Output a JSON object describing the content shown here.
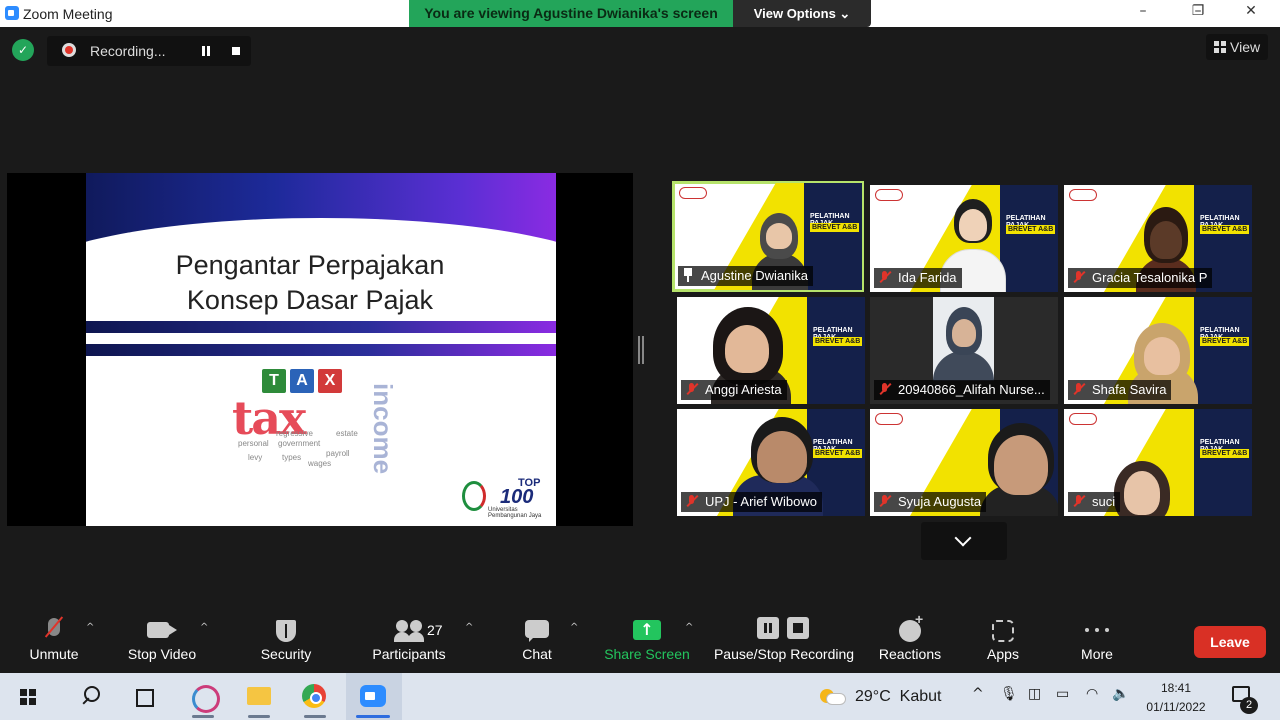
{
  "window": {
    "title": "Zoom Meeting",
    "controls": [
      "–",
      "❐",
      "✕"
    ]
  },
  "share_banner": {
    "text": "You are viewing Agustine Dwianika's screen",
    "view_options": "View Options ⌄"
  },
  "recording": {
    "label": "Recording..."
  },
  "view_button": "View",
  "slide": {
    "title_line1": "Pengantar Perpajakan",
    "title_line2": "Konsep Dasar Pajak",
    "tax_blocks": [
      "T",
      "A",
      "X"
    ],
    "tax_word": "tax",
    "income_word": "income",
    "cloud_words": [
      "government",
      "payroll",
      "wages",
      "types",
      "regressive",
      "personal",
      "estate",
      "levy"
    ],
    "logo_top": "TOP",
    "logo_number": "100",
    "logo_university": "Universitas Pembangunan Jaya"
  },
  "gallery": {
    "poster_title": "PELATIHAN PAJAK",
    "poster_brevet": "BREVET A&B",
    "participants": [
      {
        "name": "Agustine Dwianika",
        "icon": "pin",
        "active": true
      },
      {
        "name": "Ida Farida",
        "icon": "mic-muted"
      },
      {
        "name": "Gracia Tesalonika P",
        "icon": "mic-muted"
      },
      {
        "name": "Anggi Ariesta",
        "icon": "mic-muted"
      },
      {
        "name": "20940866_Alifah Nurse...",
        "icon": "mic-muted"
      },
      {
        "name": "Shafa Savira",
        "icon": "mic-muted"
      },
      {
        "name": "UPJ - Arief Wibowo",
        "icon": "mic-muted"
      },
      {
        "name": "Syuja Augusta",
        "icon": "mic-muted"
      },
      {
        "name": "suci",
        "icon": "mic-muted"
      }
    ]
  },
  "toolbar": {
    "unmute": "Unmute",
    "stop_video": "Stop Video",
    "security": "Security",
    "participants": "Participants",
    "participants_count": "27",
    "chat": "Chat",
    "share_screen": "Share Screen",
    "pause_stop_recording": "Pause/Stop Recording",
    "reactions": "Reactions",
    "apps": "Apps",
    "more": "More",
    "leave": "Leave",
    "caret": "^",
    "share_color": "#23c55e",
    "leave_color": "#d93025"
  },
  "taskbar": {
    "weather_temp": "29°C",
    "weather_desc": "Kabut",
    "tray_chevron": "^",
    "time": "18:41",
    "date": "01/11/2022",
    "notification_count": "2"
  }
}
